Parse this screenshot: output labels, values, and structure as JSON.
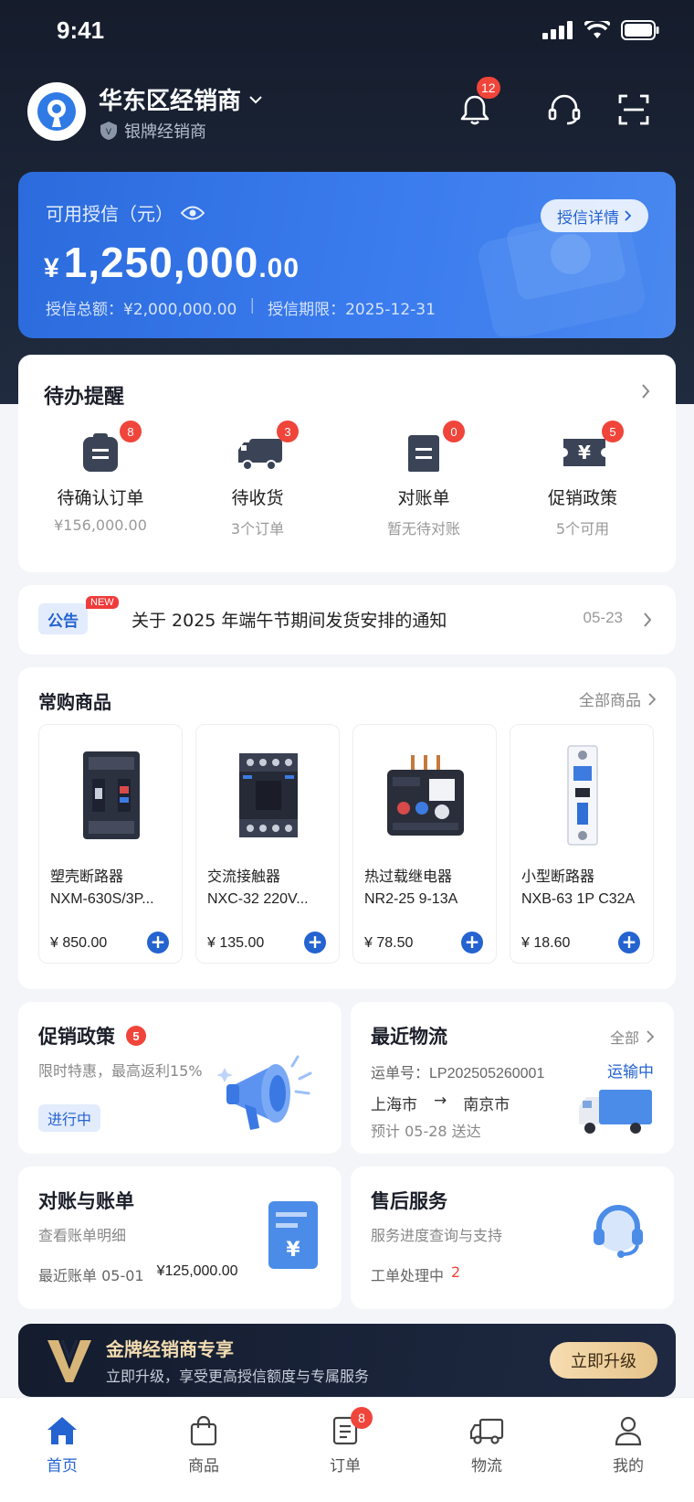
{
  "status_bar": {
    "time": "9:41"
  },
  "profile": {
    "dealer_name": "华东区经销商",
    "level": "银牌经销商",
    "notification_count": "12"
  },
  "credit": {
    "label": "可用授信（元）",
    "currency": "¥",
    "amount_int": "1,250,000",
    "amount_dec": ".00",
    "total_label": "授信总额：¥2,000,000.00",
    "period_label": "授信期限：2025-12-31",
    "detail_button": "授信详情"
  },
  "todo": {
    "title": "待办提醒",
    "items": [
      {
        "name": "待确认订单",
        "sub": "¥156,000.00",
        "count": "8",
        "icon": "clipboard-icon"
      },
      {
        "name": "待收货",
        "sub": "3个订单",
        "count": "3",
        "icon": "truck-icon"
      },
      {
        "name": "对账单",
        "sub": "暂无待对账",
        "count": "0",
        "icon": "statement-icon"
      },
      {
        "name": "促销政策",
        "sub": "5个可用",
        "count": "5",
        "icon": "coupon-icon"
      }
    ]
  },
  "notice": {
    "tag": "公告",
    "new": "NEW",
    "text": "关于 2025 年端午节期间发货安排的通知",
    "date": "05-23"
  },
  "products": {
    "title": "常购商品",
    "more": "全部商品",
    "items": [
      {
        "name": "塑壳断路器",
        "model": "NXM-630S/3P...",
        "price": "¥ 850.00"
      },
      {
        "name": "交流接触器",
        "model": "NXC-32 220V...",
        "price": "¥ 135.00"
      },
      {
        "name": "热过载继电器",
        "model": "NR2-25 9-13A",
        "price": "¥ 78.50"
      },
      {
        "name": "小型断路器",
        "model": "NXB-63 1P C32A",
        "price": "¥ 18.60"
      }
    ]
  },
  "promo": {
    "title": "促销政策",
    "count": "5",
    "sub": "限时特惠，最高返利15%",
    "status": "进行中"
  },
  "logistics": {
    "title": "最近物流",
    "more": "全部",
    "waybill": "运单号：LP202505260001",
    "status": "运输中",
    "from": "上海市",
    "arrow": "→",
    "to": "南京市",
    "eta": "预计 05-28 送达"
  },
  "billing": {
    "title": "对账与账单",
    "sub": "查看账单明细",
    "recent_label": "最近账单 05-01",
    "recent_amount": "¥125,000.00"
  },
  "aftersales": {
    "title": "售后服务",
    "sub": "服务进度查询与支持",
    "ticket_label": "工单处理中",
    "ticket_count": "2"
  },
  "gold_banner": {
    "title": "金牌经销商专享",
    "sub": "立即升级，享受更高授信额度与专属服务",
    "button": "立即升级"
  },
  "tabbar": {
    "items": [
      {
        "label": "首页"
      },
      {
        "label": "商品"
      },
      {
        "label": "订单",
        "badge": "8"
      },
      {
        "label": "物流"
      },
      {
        "label": "我的"
      }
    ]
  },
  "colors": {
    "accent": "#2463d0",
    "header_dark": "#1c2638",
    "badge_red": "#f0453a",
    "gold": "#e9c98f"
  }
}
